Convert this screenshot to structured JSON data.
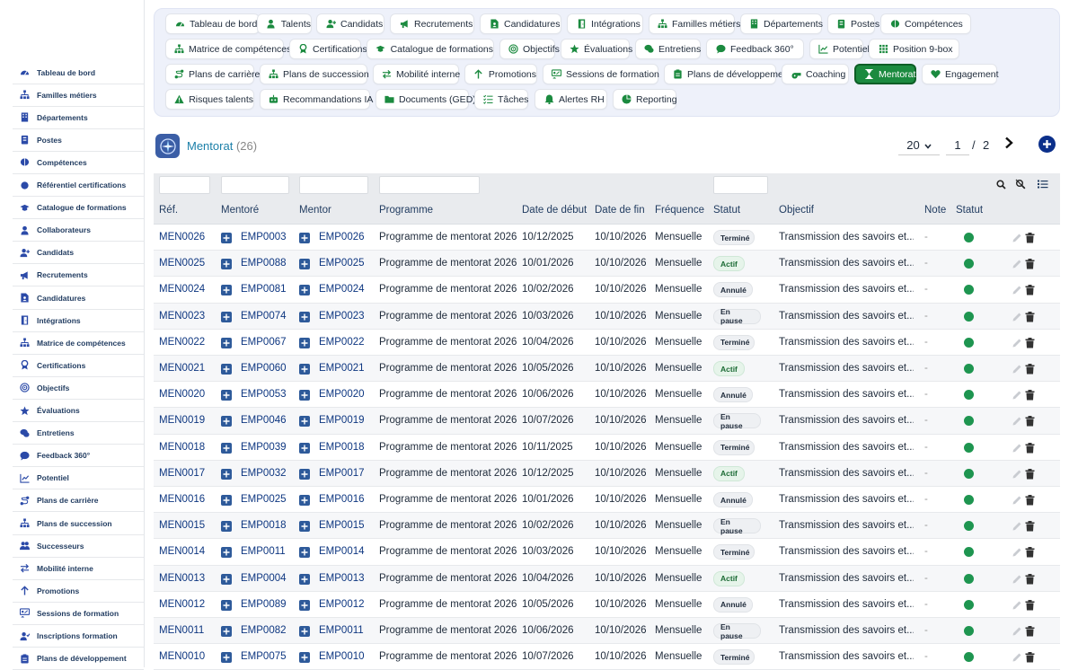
{
  "sidebar": {
    "items": [
      {
        "label": "Tableau de bord",
        "icon": "dashboard-icon"
      },
      {
        "label": "Familles métiers",
        "icon": "hierarchy-icon"
      },
      {
        "label": "Départements",
        "icon": "building-icon"
      },
      {
        "label": "Postes",
        "icon": "badge-icon"
      },
      {
        "label": "Compétences",
        "icon": "brain-icon"
      },
      {
        "label": "Référentiel certifications",
        "icon": "circle-icon"
      },
      {
        "label": "Catalogue de formations",
        "icon": "graduation-icon"
      },
      {
        "label": "Collaborateurs",
        "icon": "user-icon"
      },
      {
        "label": "Candidats",
        "icon": "user-plus-icon"
      },
      {
        "label": "Recrutements",
        "icon": "megaphone-icon"
      },
      {
        "label": "Candidatures",
        "icon": "file-user-icon"
      },
      {
        "label": "Intégrations",
        "icon": "door-icon"
      },
      {
        "label": "Matrice de compétences",
        "icon": "hierarchy-icon"
      },
      {
        "label": "Certifications",
        "icon": "award-icon"
      },
      {
        "label": "Objectifs",
        "icon": "target-icon"
      },
      {
        "label": "Évaluations",
        "icon": "star-icon"
      },
      {
        "label": "Entretiens",
        "icon": "chat-icon"
      },
      {
        "label": "Feedback 360°",
        "icon": "comment-icon"
      },
      {
        "label": "Potentiel",
        "icon": "chart-line-icon"
      },
      {
        "label": "Plans de carrière",
        "icon": "route-icon"
      },
      {
        "label": "Plans de succession",
        "icon": "hierarchy-icon"
      },
      {
        "label": "Successeurs",
        "icon": "users-icon"
      },
      {
        "label": "Mobilité interne",
        "icon": "arrows-icon"
      },
      {
        "label": "Promotions",
        "icon": "arrow-up-icon"
      },
      {
        "label": "Sessions de formation",
        "icon": "presentation-icon"
      },
      {
        "label": "Inscriptions formation",
        "icon": "user-check-icon"
      },
      {
        "label": "Plans de développement",
        "icon": "clipboard-icon"
      }
    ]
  },
  "nav": {
    "rows": [
      [
        {
          "label": "Tableau de bord",
          "icon": "dashboard-icon"
        },
        {
          "label": "Talents",
          "icon": "user-icon"
        },
        {
          "label": "Candidats",
          "icon": "user-plus-icon"
        },
        {
          "label": "Recrutements",
          "icon": "megaphone-icon"
        },
        {
          "label": "Candidatures",
          "icon": "file-user-icon"
        },
        {
          "label": "Intégrations",
          "icon": "door-icon"
        },
        {
          "label": "Familles métiers",
          "icon": "hierarchy-icon"
        },
        {
          "label": "Départements",
          "icon": "building-icon"
        },
        {
          "label": "Postes",
          "icon": "badge-icon"
        },
        {
          "label": "Compétences",
          "icon": "brain-icon"
        }
      ],
      [
        {
          "label": "Matrice de compétences",
          "icon": "hierarchy-icon"
        },
        {
          "label": "Certifications",
          "icon": "award-icon"
        },
        {
          "label": "Catalogue de formations",
          "icon": "graduation-icon"
        },
        {
          "label": "Objectifs",
          "icon": "target-icon"
        },
        {
          "label": "Évaluations",
          "icon": "star-icon"
        },
        {
          "label": "Entretiens",
          "icon": "chat-icon"
        },
        {
          "label": "Feedback 360°",
          "icon": "comment-icon"
        },
        {
          "label": "Potentiel",
          "icon": "chart-line-icon"
        },
        {
          "label": "Position 9-box",
          "icon": "grid-icon"
        }
      ],
      [
        {
          "label": "Plans de carrière",
          "icon": "route-icon"
        },
        {
          "label": "Plans de succession",
          "icon": "hierarchy-icon"
        },
        {
          "label": "Mobilité interne",
          "icon": "arrows-icon"
        },
        {
          "label": "Promotions",
          "icon": "arrow-up-icon"
        },
        {
          "label": "Sessions de formation",
          "icon": "presentation-icon"
        },
        {
          "label": "Plans de développement",
          "icon": "clipboard-icon"
        },
        {
          "label": "Coaching",
          "icon": "whistle-icon"
        },
        {
          "label": "Mentorat",
          "icon": "hourglass-icon",
          "active": true
        },
        {
          "label": "Engagement",
          "icon": "heart-icon"
        }
      ],
      [
        {
          "label": "Risques talents",
          "icon": "warning-icon"
        },
        {
          "label": "Recommandations IA",
          "icon": "robot-icon"
        },
        {
          "label": "Documents (GED)",
          "icon": "folder-icon"
        },
        {
          "label": "Tâches",
          "icon": "tasks-icon"
        },
        {
          "label": "Alertes RH",
          "icon": "bell-icon"
        },
        {
          "label": "Reporting",
          "icon": "pie-icon"
        }
      ]
    ]
  },
  "page": {
    "title": "Mentorat",
    "count": "(26)",
    "page_size": "20",
    "current_page": "1",
    "separator": "/",
    "total_pages": "2"
  },
  "colors": {
    "accent": "#1b8a3f",
    "link": "#0d3680",
    "title": "#1b7fa8",
    "status_dot": "#1e9550"
  },
  "table": {
    "columns": [
      "Réf.",
      "Mentoré",
      "Mentor",
      "Programme",
      "Date de début",
      "Date de fin",
      "Fréquence",
      "Statut",
      "Objectif",
      "Note",
      "Statut"
    ],
    "rows": [
      {
        "ref": "MEN0026",
        "mentee": "EMP0003",
        "mentor": "EMP0026",
        "programme": "Programme de mentorat 2026",
        "start": "10/12/2025",
        "end": "10/10/2026",
        "freq": "Mensuelle",
        "status": "Terminé",
        "objective": "Transmission des savoirs et...",
        "note": "-"
      },
      {
        "ref": "MEN0025",
        "mentee": "EMP0088",
        "mentor": "EMP0025",
        "programme": "Programme de mentorat 2026",
        "start": "10/01/2026",
        "end": "10/10/2026",
        "freq": "Mensuelle",
        "status": "Actif",
        "objective": "Transmission des savoirs et...",
        "note": "-"
      },
      {
        "ref": "MEN0024",
        "mentee": "EMP0081",
        "mentor": "EMP0024",
        "programme": "Programme de mentorat 2026",
        "start": "10/02/2026",
        "end": "10/10/2026",
        "freq": "Mensuelle",
        "status": "Annulé",
        "objective": "Transmission des savoirs et...",
        "note": "-"
      },
      {
        "ref": "MEN0023",
        "mentee": "EMP0074",
        "mentor": "EMP0023",
        "programme": "Programme de mentorat 2026",
        "start": "10/03/2026",
        "end": "10/10/2026",
        "freq": "Mensuelle",
        "status": "En pause",
        "objective": "Transmission des savoirs et...",
        "note": "-"
      },
      {
        "ref": "MEN0022",
        "mentee": "EMP0067",
        "mentor": "EMP0022",
        "programme": "Programme de mentorat 2026",
        "start": "10/04/2026",
        "end": "10/10/2026",
        "freq": "Mensuelle",
        "status": "Terminé",
        "objective": "Transmission des savoirs et...",
        "note": "-"
      },
      {
        "ref": "MEN0021",
        "mentee": "EMP0060",
        "mentor": "EMP0021",
        "programme": "Programme de mentorat 2026",
        "start": "10/05/2026",
        "end": "10/10/2026",
        "freq": "Mensuelle",
        "status": "Actif",
        "objective": "Transmission des savoirs et...",
        "note": "-"
      },
      {
        "ref": "MEN0020",
        "mentee": "EMP0053",
        "mentor": "EMP0020",
        "programme": "Programme de mentorat 2026",
        "start": "10/06/2026",
        "end": "10/10/2026",
        "freq": "Mensuelle",
        "status": "Annulé",
        "objective": "Transmission des savoirs et...",
        "note": "-"
      },
      {
        "ref": "MEN0019",
        "mentee": "EMP0046",
        "mentor": "EMP0019",
        "programme": "Programme de mentorat 2026",
        "start": "10/07/2026",
        "end": "10/10/2026",
        "freq": "Mensuelle",
        "status": "En pause",
        "objective": "Transmission des savoirs et...",
        "note": "-"
      },
      {
        "ref": "MEN0018",
        "mentee": "EMP0039",
        "mentor": "EMP0018",
        "programme": "Programme de mentorat 2026",
        "start": "10/11/2025",
        "end": "10/10/2026",
        "freq": "Mensuelle",
        "status": "Terminé",
        "objective": "Transmission des savoirs et...",
        "note": "-"
      },
      {
        "ref": "MEN0017",
        "mentee": "EMP0032",
        "mentor": "EMP0017",
        "programme": "Programme de mentorat 2026",
        "start": "10/12/2025",
        "end": "10/10/2026",
        "freq": "Mensuelle",
        "status": "Actif",
        "objective": "Transmission des savoirs et...",
        "note": "-"
      },
      {
        "ref": "MEN0016",
        "mentee": "EMP0025",
        "mentor": "EMP0016",
        "programme": "Programme de mentorat 2026",
        "start": "10/01/2026",
        "end": "10/10/2026",
        "freq": "Mensuelle",
        "status": "Annulé",
        "objective": "Transmission des savoirs et...",
        "note": "-"
      },
      {
        "ref": "MEN0015",
        "mentee": "EMP0018",
        "mentor": "EMP0015",
        "programme": "Programme de mentorat 2026",
        "start": "10/02/2026",
        "end": "10/10/2026",
        "freq": "Mensuelle",
        "status": "En pause",
        "objective": "Transmission des savoirs et...",
        "note": "-"
      },
      {
        "ref": "MEN0014",
        "mentee": "EMP0011",
        "mentor": "EMP0014",
        "programme": "Programme de mentorat 2026",
        "start": "10/03/2026",
        "end": "10/10/2026",
        "freq": "Mensuelle",
        "status": "Terminé",
        "objective": "Transmission des savoirs et...",
        "note": "-"
      },
      {
        "ref": "MEN0013",
        "mentee": "EMP0004",
        "mentor": "EMP0013",
        "programme": "Programme de mentorat 2026",
        "start": "10/04/2026",
        "end": "10/10/2026",
        "freq": "Mensuelle",
        "status": "Actif",
        "objective": "Transmission des savoirs et...",
        "note": "-"
      },
      {
        "ref": "MEN0012",
        "mentee": "EMP0089",
        "mentor": "EMP0012",
        "programme": "Programme de mentorat 2026",
        "start": "10/05/2026",
        "end": "10/10/2026",
        "freq": "Mensuelle",
        "status": "Annulé",
        "objective": "Transmission des savoirs et...",
        "note": "-"
      },
      {
        "ref": "MEN0011",
        "mentee": "EMP0082",
        "mentor": "EMP0011",
        "programme": "Programme de mentorat 2026",
        "start": "10/06/2026",
        "end": "10/10/2026",
        "freq": "Mensuelle",
        "status": "En pause",
        "objective": "Transmission des savoirs et...",
        "note": "-"
      },
      {
        "ref": "MEN0010",
        "mentee": "EMP0075",
        "mentor": "EMP0010",
        "programme": "Programme de mentorat 2026",
        "start": "10/07/2026",
        "end": "10/10/2026",
        "freq": "Mensuelle",
        "status": "Terminé",
        "objective": "Transmission des savoirs et...",
        "note": "-"
      }
    ]
  }
}
